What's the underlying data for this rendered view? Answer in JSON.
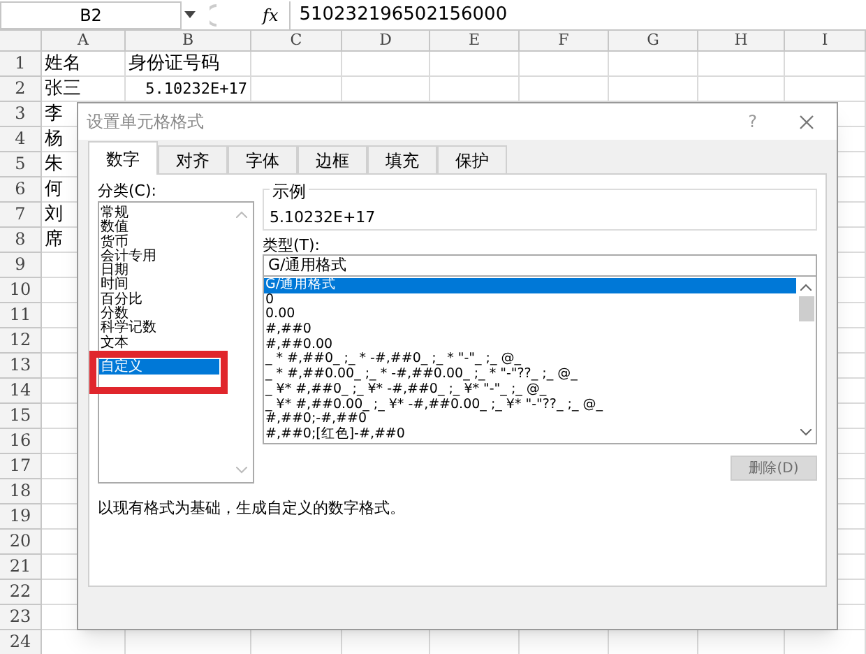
{
  "formula_bar": {
    "name_box": "B2",
    "fx": "fx",
    "value": "510232196502156000"
  },
  "sheet": {
    "columns": [
      "A",
      "B",
      "C",
      "D",
      "E",
      "F",
      "G",
      "H",
      "I"
    ],
    "rows": [
      {
        "number": "1",
        "cells": [
          "姓名",
          "身份证号码"
        ]
      },
      {
        "number": "2",
        "cells": [
          "张三",
          "5.10232E+17"
        ]
      },
      {
        "number": "3",
        "cells": [
          "李"
        ]
      },
      {
        "number": "4",
        "cells": [
          "杨"
        ]
      },
      {
        "number": "5",
        "cells": [
          "朱"
        ]
      },
      {
        "number": "6",
        "cells": [
          "何"
        ]
      },
      {
        "number": "7",
        "cells": [
          "刘"
        ]
      },
      {
        "number": "8",
        "cells": [
          "席"
        ]
      },
      {
        "number": "9",
        "cells": []
      },
      {
        "number": "10",
        "cells": []
      },
      {
        "number": "11",
        "cells": []
      },
      {
        "number": "12",
        "cells": []
      },
      {
        "number": "13",
        "cells": []
      },
      {
        "number": "14",
        "cells": []
      },
      {
        "number": "15",
        "cells": []
      },
      {
        "number": "16",
        "cells": []
      },
      {
        "number": "17",
        "cells": []
      },
      {
        "number": "18",
        "cells": []
      },
      {
        "number": "19",
        "cells": []
      },
      {
        "number": "20",
        "cells": []
      },
      {
        "number": "21",
        "cells": []
      },
      {
        "number": "22",
        "cells": []
      },
      {
        "number": "23",
        "cells": []
      },
      {
        "number": "24",
        "cells": []
      }
    ]
  },
  "dialog": {
    "title": "设置单元格格式",
    "help": "?",
    "tabs": [
      {
        "label": "数字",
        "selected": true
      },
      {
        "label": "对齐",
        "selected": false
      },
      {
        "label": "字体",
        "selected": false
      },
      {
        "label": "边框",
        "selected": false
      },
      {
        "label": "填充",
        "selected": false
      },
      {
        "label": "保护",
        "selected": false
      }
    ],
    "category_label": "分类(C):",
    "categories": [
      {
        "label": "常规",
        "selected": false,
        "annotated": false
      },
      {
        "label": "数值",
        "selected": false,
        "annotated": false
      },
      {
        "label": "货币",
        "selected": false,
        "annotated": false
      },
      {
        "label": "会计专用",
        "selected": false,
        "annotated": false
      },
      {
        "label": "日期",
        "selected": false,
        "annotated": false
      },
      {
        "label": "时间",
        "selected": false,
        "annotated": false
      },
      {
        "label": "百分比",
        "selected": false,
        "annotated": false
      },
      {
        "label": "分数",
        "selected": false,
        "annotated": false
      },
      {
        "label": "科学记数",
        "selected": false,
        "annotated": false
      },
      {
        "label": "文本",
        "selected": false,
        "annotated": false
      },
      {
        "label": "自定义",
        "selected": true,
        "annotated": true
      }
    ],
    "sample_label": "示例",
    "sample_value": "5.10232E+17",
    "type_label": "类型(T):",
    "type_value": "G/通用格式",
    "formats": [
      {
        "label": "G/通用格式",
        "selected": true
      },
      {
        "label": "0",
        "selected": false
      },
      {
        "label": "0.00",
        "selected": false
      },
      {
        "label": "#,##0",
        "selected": false
      },
      {
        "label": "#,##0.00",
        "selected": false
      },
      {
        "label": "_ * #,##0_ ;_ * -#,##0_ ;_ * \"-\"_ ;_ @_",
        "selected": false
      },
      {
        "label": "_ * #,##0.00_ ;_ * -#,##0.00_ ;_ * \"-\"??_ ;_ @_",
        "selected": false
      },
      {
        "label": "_ ¥* #,##0_ ;_ ¥* -#,##0_ ;_ ¥* \"-\"_ ;_ @_",
        "selected": false
      },
      {
        "label": "_ ¥* #,##0.00_ ;_ ¥* -#,##0.00_ ;_ ¥* \"-\"??_ ;_ @_",
        "selected": false
      },
      {
        "label": "#,##0;-#,##0",
        "selected": false
      },
      {
        "label": "#,##0;[红色]-#,##0",
        "selected": false
      }
    ],
    "delete_button": {
      "label": "删除(D)",
      "disabled": true
    },
    "description": "以现有格式为基础，生成自定义的数字格式。"
  }
}
